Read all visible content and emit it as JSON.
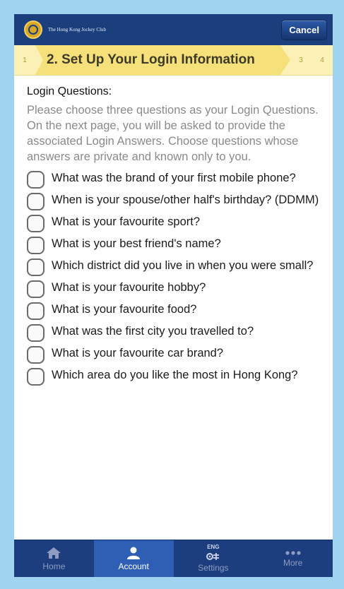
{
  "header": {
    "brand": "The Hong Kong Jockey Club",
    "cancel_label": "Cancel"
  },
  "steps": {
    "prev": "1",
    "current": "2. Set Up Your Login Information",
    "next": "3",
    "last": "4"
  },
  "content": {
    "title": "Login Questions:",
    "intro": "Please choose three questions as your Login Questions. On the next page, you will be asked to provide the associated Login Answers. Choose questions whose answers are private and known only to you.",
    "questions": [
      {
        "text": "What was the brand of your first mobile phone?",
        "checked": false
      },
      {
        "text": "When is your spouse/other half's birthday? (DDMM)",
        "checked": false
      },
      {
        "text": "What is your favourite sport?",
        "checked": false
      },
      {
        "text": "What is your best friend's name?",
        "checked": false
      },
      {
        "text": "Which district did you live in when you were small?",
        "checked": false
      },
      {
        "text": "What is your favourite hobby?",
        "checked": false
      },
      {
        "text": "What is your favourite food?",
        "checked": false
      },
      {
        "text": "What was the first city you travelled to?",
        "checked": false
      },
      {
        "text": "What is your favourite car brand?",
        "checked": false
      },
      {
        "text": "Which area do you like the most in Hong Kong?",
        "checked": false
      }
    ]
  },
  "tabbar": {
    "items": [
      {
        "label": "Home",
        "icon": "home-icon",
        "active": false
      },
      {
        "label": "Account",
        "icon": "person-icon",
        "active": true
      },
      {
        "label": "Settings",
        "icon": "settings-icon",
        "active": false,
        "badge": "ENG"
      },
      {
        "label": "More",
        "icon": "more-icon",
        "active": false
      }
    ]
  },
  "colors": {
    "header_bg": "#1b3f7d",
    "step_bg": "#f5e07a",
    "tab_active": "#2f5fb4",
    "frame": "#9fd3f0"
  }
}
